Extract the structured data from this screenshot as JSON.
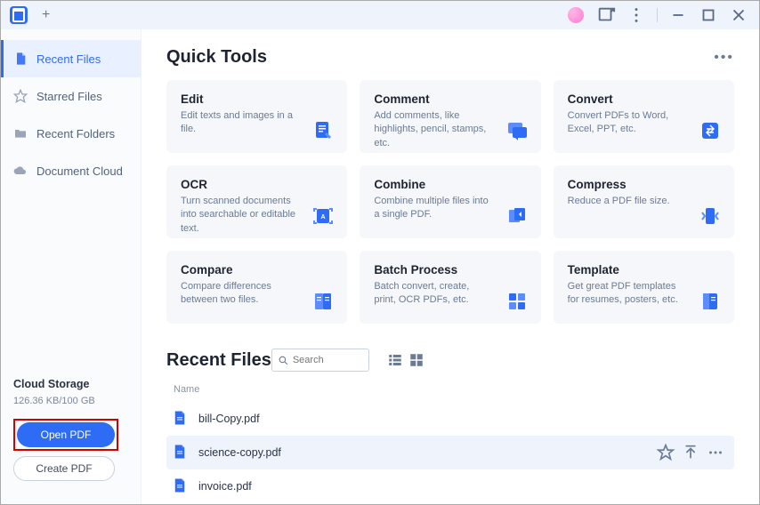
{
  "titlebar": {
    "new_tab_tooltip": "+"
  },
  "sidebar": {
    "items": [
      {
        "label": "Recent Files",
        "icon": "file-icon",
        "active": true
      },
      {
        "label": "Starred Files",
        "icon": "star-icon",
        "active": false
      },
      {
        "label": "Recent Folders",
        "icon": "folder-icon",
        "active": false
      },
      {
        "label": "Document Cloud",
        "icon": "cloud-icon",
        "active": false
      }
    ],
    "storage_label": "Cloud Storage",
    "storage_value": "126.36 KB/100 GB",
    "open_pdf_label": "Open PDF",
    "create_pdf_label": "Create PDF"
  },
  "quick_tools": {
    "title": "Quick Tools",
    "tools": [
      {
        "title": "Edit",
        "desc": "Edit texts and images in a file.",
        "icon": "edit"
      },
      {
        "title": "Comment",
        "desc": "Add comments, like highlights, pencil, stamps, etc.",
        "icon": "comment"
      },
      {
        "title": "Convert",
        "desc": "Convert PDFs to Word, Excel, PPT, etc.",
        "icon": "convert"
      },
      {
        "title": "OCR",
        "desc": "Turn scanned documents into searchable or editable text.",
        "icon": "ocr"
      },
      {
        "title": "Combine",
        "desc": "Combine multiple files into a single PDF.",
        "icon": "combine"
      },
      {
        "title": "Compress",
        "desc": "Reduce a PDF file size.",
        "icon": "compress"
      },
      {
        "title": "Compare",
        "desc": "Compare differences between two files.",
        "icon": "compare"
      },
      {
        "title": "Batch Process",
        "desc": "Batch convert, create, print, OCR PDFs, etc.",
        "icon": "batch"
      },
      {
        "title": "Template",
        "desc": "Get great PDF templates for resumes, posters, etc.",
        "icon": "template"
      }
    ]
  },
  "recent_files": {
    "title": "Recent Files",
    "search_placeholder": "Search",
    "column_name": "Name",
    "files": [
      {
        "name": "bill-Copy.pdf",
        "hovered": false
      },
      {
        "name": "science-copy.pdf",
        "hovered": true
      },
      {
        "name": "invoice.pdf",
        "hovered": false
      }
    ]
  }
}
